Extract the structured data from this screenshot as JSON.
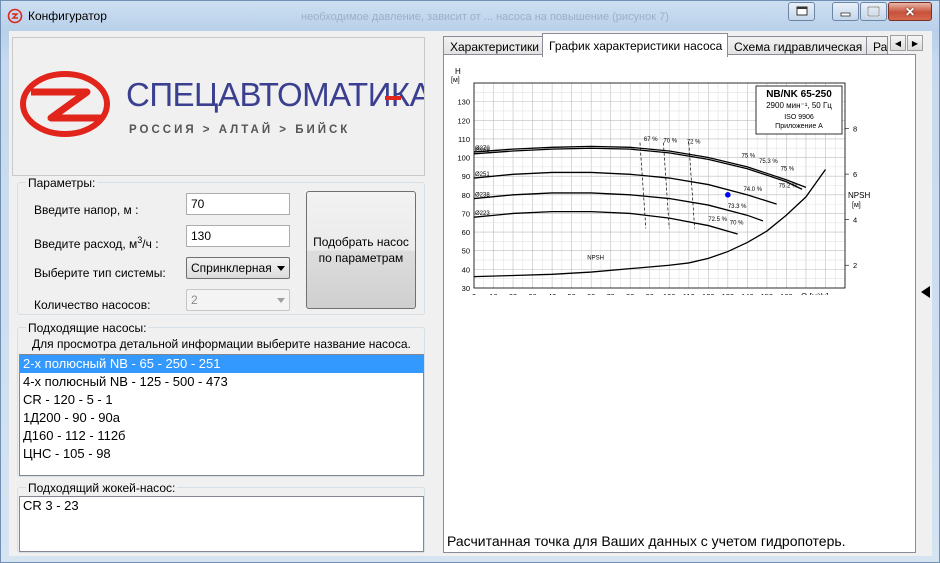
{
  "window": {
    "title": "Конфигуратор",
    "ghost_title": "необходимое давление, зависит от ... насоса на повышение (рисунок 7)"
  },
  "logo": {
    "name": "СПЕЦАВТОМАТИКА",
    "subtitle": "РОССИЯ > АЛТАЙ > БИЙСК",
    "brand_color": "#e1251b",
    "text_color": "#3a3f8f"
  },
  "params": {
    "title": "Параметры:",
    "head_label": "Введите напор, м :",
    "head_value": "70",
    "flow_label": "Введите расход, м³/ч :",
    "flow_value": "130",
    "system_label": "Выберите тип системы:",
    "system_value": "Спринклерная",
    "count_label": "Количество насосов:",
    "count_value": "2",
    "select_button": "Подобрать насос\nпо параметрам"
  },
  "pumps": {
    "title": "Подходящие насосы:",
    "hint": "Для просмотра детальной информации выберите название насоса.",
    "items": [
      "2-х полюсный NB - 65 - 250 - 251",
      "4-х полюсный NB - 125 - 500 - 473",
      "CR - 120 - 5 - 1",
      "1Д200 - 90 - 90а",
      "Д160 - 112 - 112б",
      "ЦНС - 105 - 98"
    ],
    "selected_index": 0
  },
  "jockey": {
    "title": "Подходящий жокей-насос:",
    "value": "CR 3 - 23"
  },
  "tabs": [
    "Характеристики",
    "График характеристики насоса",
    "Схема гидравлическая",
    "Ра"
  ],
  "active_tab": 1,
  "chart_data": {
    "type": "line",
    "title": "NB/NK 65-250",
    "subtitle": "2900 мин⁻¹, 50 Гц",
    "standard": "ISO 9906",
    "annex": "Приложение А",
    "ylabel": "H",
    "yunit": "[м]",
    "y2label": "NPSH",
    "y2unit": "[м]",
    "xlabel": "Q",
    "xunit": "[м³/ч]",
    "xlim": [
      0,
      190
    ],
    "ylim": [
      30,
      140
    ],
    "y2lim": [
      1,
      10
    ],
    "x_ticks": [
      0,
      10,
      20,
      30,
      40,
      50,
      60,
      70,
      80,
      90,
      100,
      110,
      120,
      130,
      140,
      150,
      160
    ],
    "y_ticks": [
      30,
      40,
      50,
      60,
      70,
      80,
      90,
      100,
      110,
      120,
      130
    ],
    "y2_ticks": [
      2,
      4,
      6,
      8
    ],
    "grid": true,
    "series": [
      {
        "name": "Ø270",
        "x": [
          0,
          20,
          40,
          60,
          80,
          100,
          120,
          140,
          160,
          170
        ],
        "y": [
          103,
          104.5,
          105.5,
          106,
          105.5,
          103.5,
          100,
          95,
          88,
          84
        ]
      },
      {
        "name": "Ø269",
        "x": [
          0,
          20,
          40,
          60,
          80,
          100,
          120,
          140,
          160,
          168
        ],
        "y": [
          102,
          103.5,
          104.5,
          105,
          104.5,
          102.5,
          99,
          94,
          87,
          83
        ]
      },
      {
        "name": "Ø251",
        "x": [
          0,
          20,
          40,
          60,
          80,
          100,
          120,
          140,
          155
        ],
        "y": [
          89,
          91,
          92,
          92,
          91,
          89,
          85.5,
          80,
          75
        ]
      },
      {
        "name": "Ø238",
        "x": [
          0,
          20,
          40,
          60,
          80,
          100,
          120,
          140,
          148
        ],
        "y": [
          78,
          80,
          81,
          81,
          80,
          78,
          74.5,
          69,
          66
        ]
      },
      {
        "name": "Ø223",
        "x": [
          0,
          20,
          40,
          60,
          80,
          100,
          120,
          135
        ],
        "y": [
          68,
          70,
          71,
          71,
          70,
          67.5,
          63.5,
          59
        ]
      }
    ],
    "npsh": {
      "name": "NPSH",
      "x": [
        0,
        20,
        40,
        60,
        80,
        100,
        110,
        120,
        130,
        140,
        150,
        160,
        170,
        180
      ],
      "y": [
        1.5,
        1.55,
        1.6,
        1.7,
        1.85,
        2.0,
        2.1,
        2.3,
        2.6,
        3.0,
        3.5,
        4.2,
        5.0,
        6.2
      ]
    },
    "efficiency_labels": [
      "67 %",
      "70 %",
      "72 %",
      "75 %",
      "75.3 %",
      "75 %",
      "74.0 %",
      "75.2 %",
      "73.3 %",
      "72.5 %",
      "70 %"
    ],
    "operating_point": {
      "x": 130,
      "y": 80,
      "color": "#0000ff"
    }
  },
  "chart_note": "Расчитанная точка для Ваших данных с учетом гидропотерь."
}
